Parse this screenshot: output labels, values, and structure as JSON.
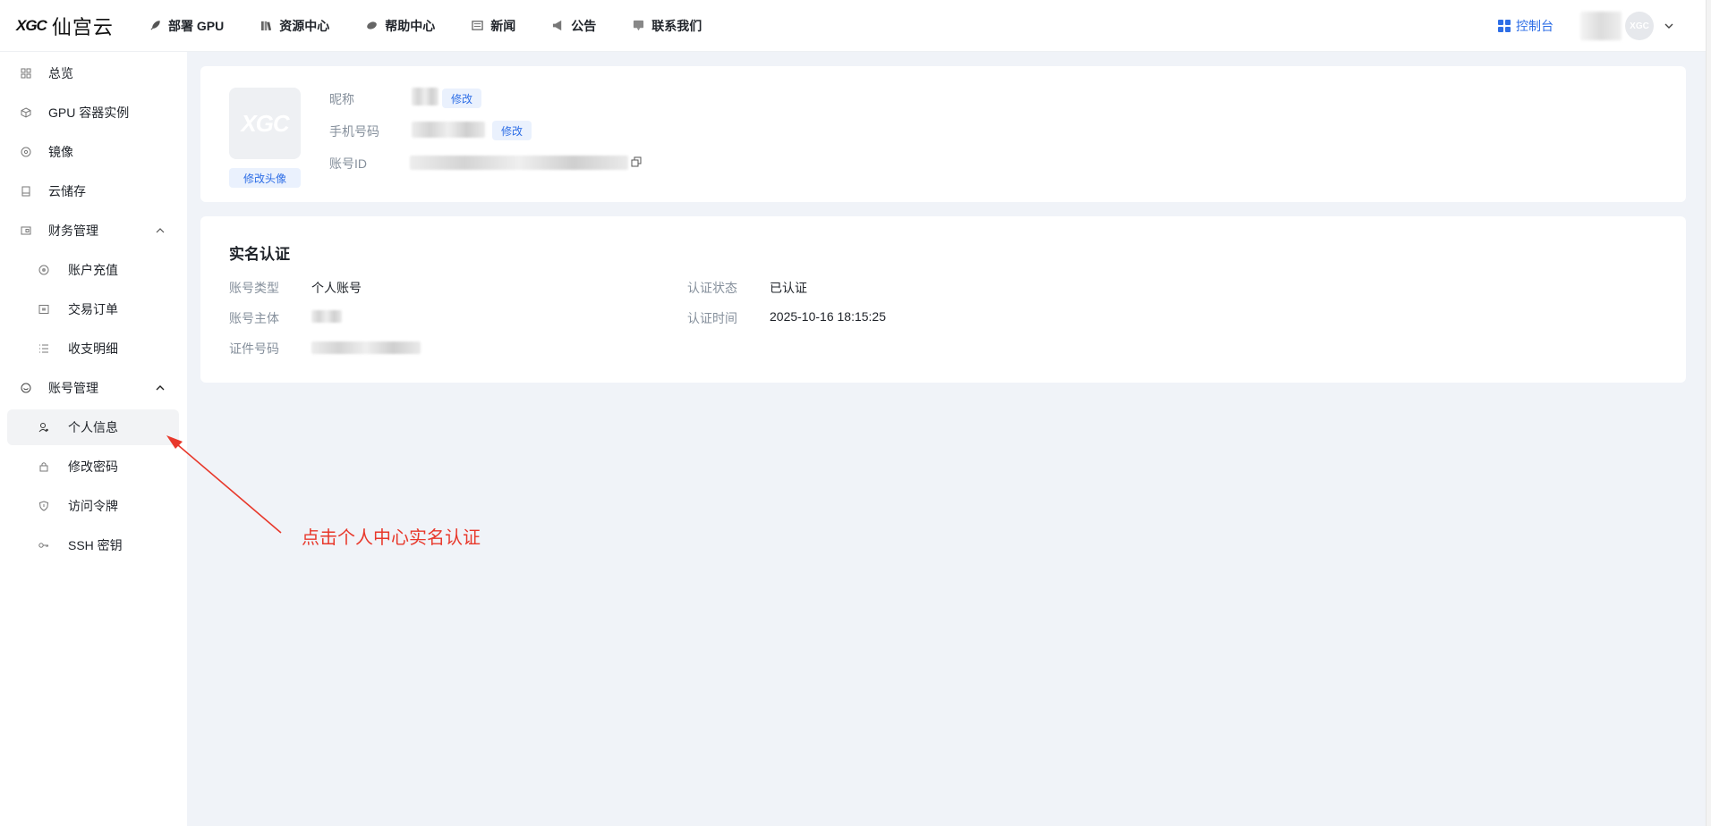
{
  "header": {
    "logo_mark": "XGC",
    "logo_text": "仙宫云",
    "nav": [
      {
        "label": "部署 GPU",
        "icon": "rocket-icon"
      },
      {
        "label": "资源中心",
        "icon": "books-icon"
      },
      {
        "label": "帮助中心",
        "icon": "help-icon"
      },
      {
        "label": "新闻",
        "icon": "news-icon"
      },
      {
        "label": "公告",
        "icon": "megaphone-icon"
      },
      {
        "label": "联系我们",
        "icon": "chat-icon"
      }
    ],
    "console_label": "控制台",
    "avatar_mark": "XGC",
    "accent": "#2e6ee6"
  },
  "sidebar": {
    "items": [
      {
        "label": "总览",
        "icon": "dashboard-icon"
      },
      {
        "label": "GPU 容器实例",
        "icon": "cube-icon"
      },
      {
        "label": "镜像",
        "icon": "disc-icon"
      },
      {
        "label": "云储存",
        "icon": "storage-icon"
      },
      {
        "label": "财务管理",
        "icon": "wallet-icon",
        "expanded": true
      },
      {
        "label": "账户充值",
        "icon": "coin-icon"
      },
      {
        "label": "交易订单",
        "icon": "order-icon"
      },
      {
        "label": "收支明细",
        "icon": "list-icon"
      },
      {
        "label": "账号管理",
        "icon": "smile-icon",
        "expanded": true
      },
      {
        "label": "个人信息",
        "icon": "user-icon",
        "active": true
      },
      {
        "label": "修改密码",
        "icon": "lock-icon"
      },
      {
        "label": "访问令牌",
        "icon": "shield-icon"
      },
      {
        "label": "SSH 密钥",
        "icon": "key-icon"
      }
    ]
  },
  "profile": {
    "avatar_mark": "XGC",
    "change_avatar": "修改头像",
    "nickname_label": "昵称",
    "phone_label": "手机号码",
    "account_id_label": "账号ID",
    "edit_label": "修改"
  },
  "verification": {
    "title": "实名认证",
    "account_type_label": "账号类型",
    "account_type_value": "个人账号",
    "subject_label": "账号主体",
    "id_number_label": "证件号码",
    "status_label": "认证状态",
    "status_value": "已认证",
    "time_label": "认证时间",
    "time_value": "2025-10-16 18:15:25"
  },
  "annotation": {
    "text": "点击个人中心实名认证",
    "color": "#e8382b"
  }
}
